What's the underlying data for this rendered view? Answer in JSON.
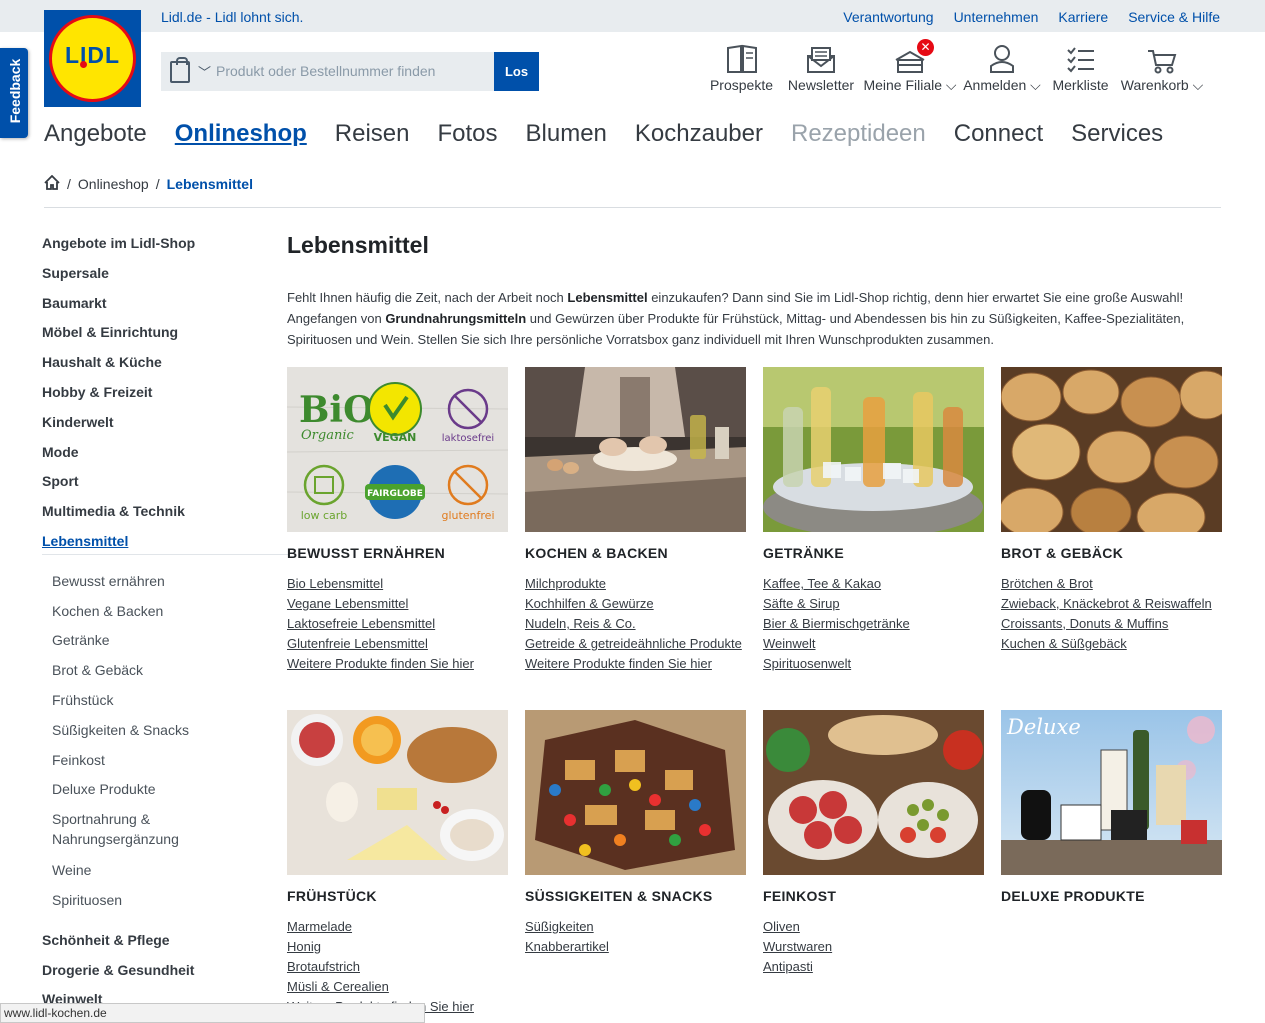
{
  "topbar": {
    "slogan": "Lidl.de - Lidl lohnt sich.",
    "links": [
      "Verantwortung",
      "Unternehmen",
      "Karriere",
      "Service & Hilfe"
    ]
  },
  "logo": {
    "text": "LIDL"
  },
  "feedback": {
    "label": "Feedback"
  },
  "search": {
    "placeholder": "Produkt oder Bestellnummer finden",
    "button": "Los"
  },
  "header_icons": [
    {
      "label": "Prospekte",
      "icon": "brochure-icon"
    },
    {
      "label": "Newsletter",
      "icon": "newsletter-icon"
    },
    {
      "label": "Meine Filiale ⌵",
      "icon": "store-icon",
      "badge": "✕"
    },
    {
      "label": "Anmelden ⌵",
      "icon": "user-icon"
    },
    {
      "label": "Merkliste",
      "icon": "checklist-icon"
    },
    {
      "label": "Warenkorb ⌵",
      "icon": "cart-icon"
    }
  ],
  "main_nav": [
    "Angebote",
    "Onlineshop",
    "Reisen",
    "Fotos",
    "Blumen",
    "Kochzauber",
    "Rezeptideen",
    "Connect",
    "Services"
  ],
  "breadcrumb": {
    "home_icon": "home-icon",
    "items": [
      "Onlineshop",
      "Lebensmittel"
    ]
  },
  "sidebar": {
    "main_items": [
      "Angebote im Lidl-Shop",
      "Supersale",
      "Baumarkt",
      "Möbel & Einrichtung",
      "Haushalt & Küche",
      "Hobby & Freizeit",
      "Kinderwelt",
      "Mode",
      "Sport",
      "Multimedia & Technik",
      "Lebensmittel"
    ],
    "sub_items": [
      "Bewusst ernähren",
      "Kochen & Backen",
      "Getränke",
      "Brot & Gebäck",
      "Frühstück",
      "Süßigkeiten & Snacks",
      "Feinkost",
      "Deluxe Produkte",
      "Sportnahrung & Nahrungsergänzung",
      "Weine",
      "Spirituosen"
    ],
    "after_items": [
      "Schönheit & Pflege",
      "Drogerie & Gesundheit",
      "Weinwelt"
    ]
  },
  "content": {
    "title": "Lebensmittel",
    "intro": {
      "p1": "Fehlt Ihnen häufig die Zeit, nach der Arbeit noch ",
      "b1": "Lebensmittel",
      "p2": " einzukaufen? Dann sind Sie im Lidl-Shop richtig, denn hier erwartet Sie eine große Auswahl! Angefangen von ",
      "b2": "Grundnahrungsmitteln",
      "p3": " und Gewürzen über Produkte für Frühstück, Mittag- und Abendessen bis hin zu Süßigkeiten, Kaffee-Spezialitäten, Spirituosen und Wein. Stellen Sie sich Ihre persönliche Vorratsbox ganz individuell mit Ihren Wunschprodukten zusammen."
    },
    "categories": [
      {
        "title": "BEWUSST ERNÄHREN",
        "image": "diet-labels",
        "labels": {
          "bio1": "BiO",
          "bio2": "Organic",
          "vegan": "VEGAN",
          "lakt": "laktosefrei",
          "lowcarb": "low carb",
          "fair": "FAIRGLOBE",
          "gluten": "glutenfrei"
        },
        "links": [
          "Bio Lebensmittel",
          "Vegane Lebensmittel",
          "Laktosefreie Lebensmittel",
          "Glutenfreie Lebensmittel",
          "Weitere Produkte finden Sie hier"
        ]
      },
      {
        "title": "KOCHEN & BACKEN",
        "image": "baking",
        "links": [
          "Milchprodukte",
          "Kochhilfen & Gewürze",
          "Nudeln, Reis & Co.",
          "Getreide & getreideähnliche Produkte",
          "Weitere Produkte finden Sie hier"
        ]
      },
      {
        "title": "GETRÄNKE",
        "image": "drinks",
        "links": [
          "Kaffee, Tee & Kakao",
          "Säfte & Sirup",
          "Bier & Biermischgetränke",
          "Weinwelt",
          "Spirituosenwelt"
        ]
      },
      {
        "title": "BROT & GEBÄCK",
        "image": "bread",
        "links": [
          "Brötchen & Brot",
          "Zwieback, Knäckebrot & Reiswaffeln",
          "Croissants, Donuts & Muffins",
          "Kuchen & Süßgebäck"
        ]
      },
      {
        "title": "FRÜHSTÜCK",
        "image": "breakfast",
        "links": [
          "Marmelade",
          "Honig",
          "Brotaufstrich",
          "Müsli & Cerealien",
          "Weitere Produkte finden Sie hier"
        ]
      },
      {
        "title": "SÜSSIGKEITEN & SNACKS",
        "image": "sweets",
        "links": [
          "Süßigkeiten",
          "Knabberartikel"
        ]
      },
      {
        "title": "FEINKOST",
        "image": "deli",
        "links": [
          "Oliven",
          "Wurstwaren",
          "Antipasti"
        ]
      },
      {
        "title": "DELUXE PRODUKTE",
        "image": "deluxe",
        "labels": {
          "brand": "Deluxe"
        },
        "links": []
      }
    ]
  },
  "statusbar": {
    "url": "www.lidl-kochen.de"
  },
  "colors": {
    "lidl_blue": "#0050aa",
    "lidl_yellow": "#ffe500",
    "lidl_red": "#e60a14",
    "topbar_bg": "#e8ecef"
  }
}
